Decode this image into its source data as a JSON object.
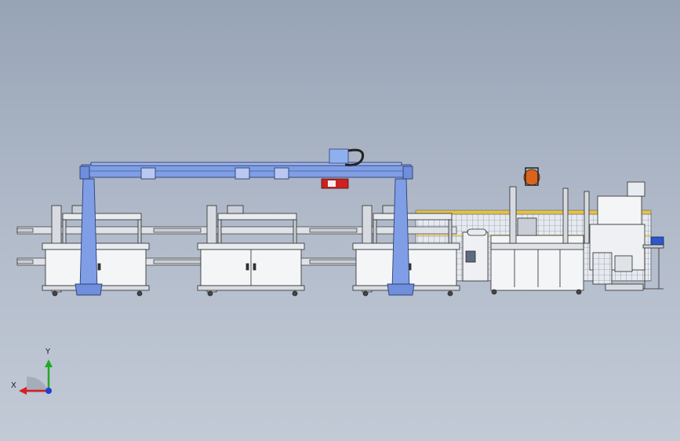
{
  "viewport": {
    "background_top": "#97a4b6",
    "background_bottom": "#c2cad6"
  },
  "colors": {
    "gantry_blue": "#7f9ee6",
    "gantry_edge": "#2e3f73",
    "frame": "#e8ebef",
    "line": "#2a2a2a",
    "accent_red": "#cc2222",
    "accent_orange": "#d9641c",
    "accent_yellow": "#e3c24a",
    "bin_blue": "#2e57c8"
  },
  "triad": {
    "x_label": "X",
    "y_label": "Y",
    "x_color": "#d81e1e",
    "y_color": "#22aa22",
    "z_color": "#1e3fd8"
  }
}
